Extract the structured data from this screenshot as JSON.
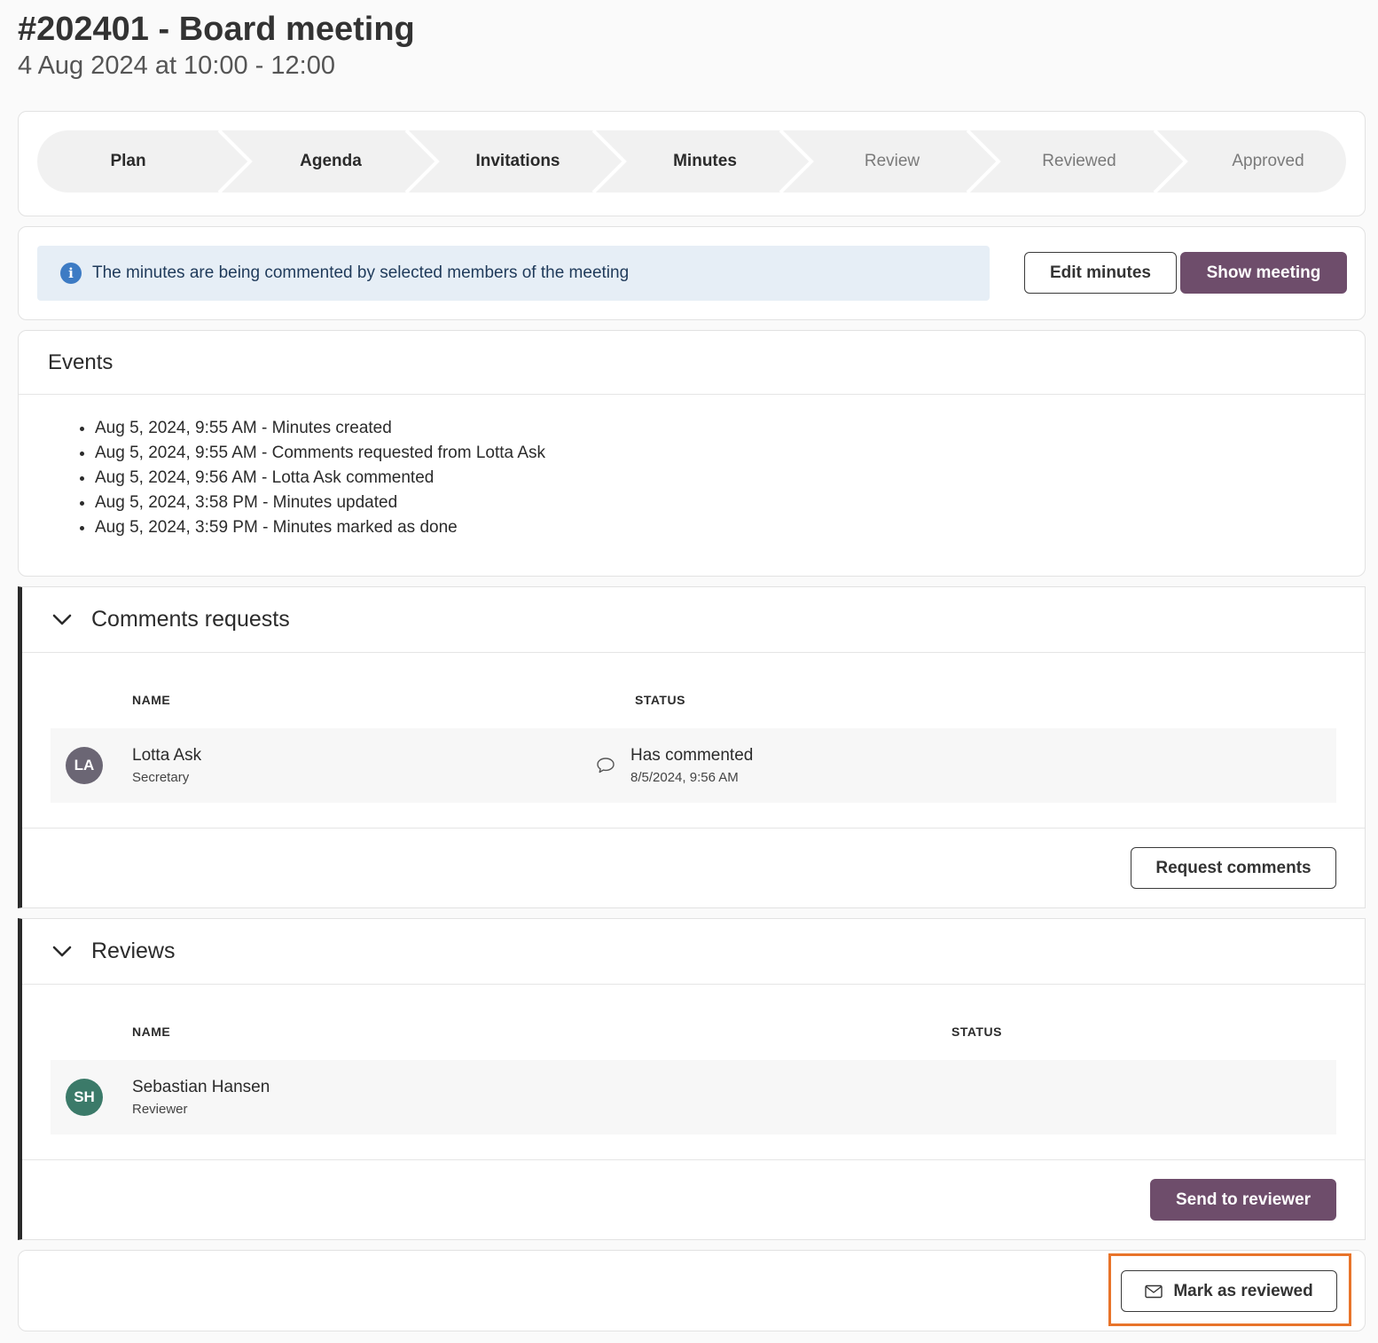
{
  "meeting": {
    "title": "#202401 - Board meeting",
    "subtitle": "4 Aug 2024 at 10:00 - 12:00"
  },
  "stepper": {
    "steps": [
      {
        "label": "Plan",
        "state": "done"
      },
      {
        "label": "Agenda",
        "state": "done"
      },
      {
        "label": "Invitations",
        "state": "done"
      },
      {
        "label": "Minutes",
        "state": "done"
      },
      {
        "label": "Review",
        "state": "future"
      },
      {
        "label": "Reviewed",
        "state": "future"
      },
      {
        "label": "Approved",
        "state": "future"
      }
    ]
  },
  "status_bar": {
    "info_icon": "info-icon",
    "message": "The minutes are being commented by selected members of the meeting",
    "edit_label": "Edit minutes",
    "show_label": "Show meeting"
  },
  "events": {
    "title": "Events",
    "items": [
      "Aug 5, 2024, 9:55 AM - Minutes created",
      "Aug 5, 2024, 9:55 AM - Comments requested from Lotta Ask",
      "Aug 5, 2024, 9:56 AM - Lotta Ask commented",
      "Aug 5, 2024, 3:58 PM - Minutes updated",
      "Aug 5, 2024, 3:59 PM - Minutes marked as done"
    ]
  },
  "comments_requests": {
    "title": "Comments requests",
    "col_name": "NAME",
    "col_status": "STATUS",
    "rows": [
      {
        "initials": "LA",
        "name": "Lotta Ask",
        "role": "Secretary",
        "status": "Has commented",
        "status_time": "8/5/2024, 9:56 AM",
        "status_icon": "comment-bubble-icon"
      }
    ],
    "action_label": "Request comments"
  },
  "reviews": {
    "title": "Reviews",
    "col_name": "NAME",
    "col_status": "STATUS",
    "rows": [
      {
        "initials": "SH",
        "name": "Sebastian Hansen",
        "role": "Reviewer"
      }
    ],
    "action_label": "Send to reviewer"
  },
  "bottom": {
    "mark_label": "Mark as reviewed",
    "mark_icon": "envelope-icon"
  },
  "colors": {
    "primary": "#6e4d6b",
    "avatar_la": "#6b6674",
    "avatar_sh": "#3b7a69",
    "info_bg": "#e6eef6",
    "info_icon": "#3d7bc4",
    "highlight": "#e8742a",
    "accent_border": "#2a2a2a"
  }
}
